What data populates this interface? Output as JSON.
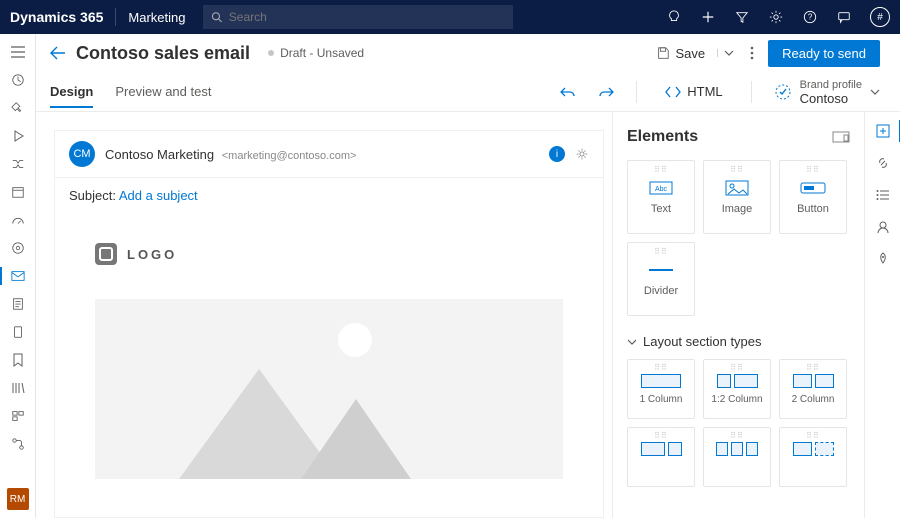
{
  "topbar": {
    "brand": "Dynamics 365",
    "app": "Marketing",
    "search_placeholder": "Search"
  },
  "page": {
    "title": "Contoso sales email",
    "status": "Draft - Unsaved",
    "save_label": "Save",
    "primary_action": "Ready to send"
  },
  "tabs": {
    "design": "Design",
    "preview": "Preview and test",
    "html_tool": "HTML",
    "brand_profile_label": "Brand profile",
    "brand_profile_name": "Contoso"
  },
  "email": {
    "sender_initials": "CM",
    "sender_name": "Contoso Marketing",
    "sender_addr": "<marketing@contoso.com>",
    "subject_label": "Subject:",
    "subject_link": "Add a subject",
    "logo_text": "LOGO"
  },
  "panel": {
    "title": "Elements",
    "tiles": {
      "text": "Text",
      "image": "Image",
      "button": "Button",
      "divider": "Divider"
    },
    "section_title": "Layout section types",
    "layouts": {
      "c1": "1 Column",
      "c12": "1:2 Column",
      "c2": "2 Column"
    }
  },
  "leftrail_avatar": "RM"
}
